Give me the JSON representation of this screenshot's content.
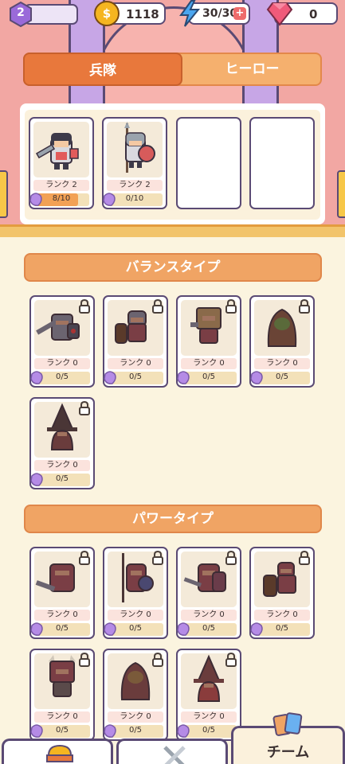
{
  "topbar": {
    "level": "2",
    "coins": "1118",
    "energy": "30/30",
    "gems": "0",
    "energy_plus": "+"
  },
  "tabs": [
    {
      "label": "兵隊",
      "active": true
    },
    {
      "label": "ヒーロー",
      "active": false
    }
  ],
  "equipped": [
    {
      "rank": "ランク 2",
      "count": "8/10",
      "progress": 0.8,
      "unit": "sword-knight"
    },
    {
      "rank": "ランク 2",
      "count": "0/10",
      "progress": 0,
      "unit": "spear-knight"
    }
  ],
  "sections": {
    "balance": {
      "title": "バランスタイプ",
      "units": [
        {
          "rank": "ランク 0",
          "count": "0/5",
          "unit": "shield-knight"
        },
        {
          "rank": "ランク 0",
          "count": "0/5",
          "unit": "cavalry"
        },
        {
          "rank": "ランク 0",
          "count": "0/5",
          "unit": "box-warrior"
        },
        {
          "rank": "ランク 0",
          "count": "0/5",
          "unit": "hooded-monk"
        },
        {
          "rank": "ランク 0",
          "count": "0/5",
          "unit": "witch"
        }
      ]
    },
    "power": {
      "title": "パワータイプ",
      "units": [
        {
          "rank": "ランク 0",
          "count": "0/5",
          "unit": "sword-brute"
        },
        {
          "rank": "ランク 0",
          "count": "0/5",
          "unit": "spear-guard"
        },
        {
          "rank": "ランク 0",
          "count": "0/5",
          "unit": "shield-guard"
        },
        {
          "rank": "ランク 0",
          "count": "0/5",
          "unit": "horse-rider"
        },
        {
          "rank": "ランク 0",
          "count": "0/5",
          "unit": "horned-box"
        },
        {
          "rank": "ランク 0",
          "count": "0/5",
          "unit": "dark-monk"
        },
        {
          "rank": "ランク 0",
          "count": "0/5",
          "unit": "red-witch"
        }
      ]
    }
  },
  "bottom_nav": {
    "team_label": "チーム"
  },
  "colors": {
    "accent": "#e8783c",
    "outline": "#5a4a74",
    "shard": "#b58be6"
  }
}
